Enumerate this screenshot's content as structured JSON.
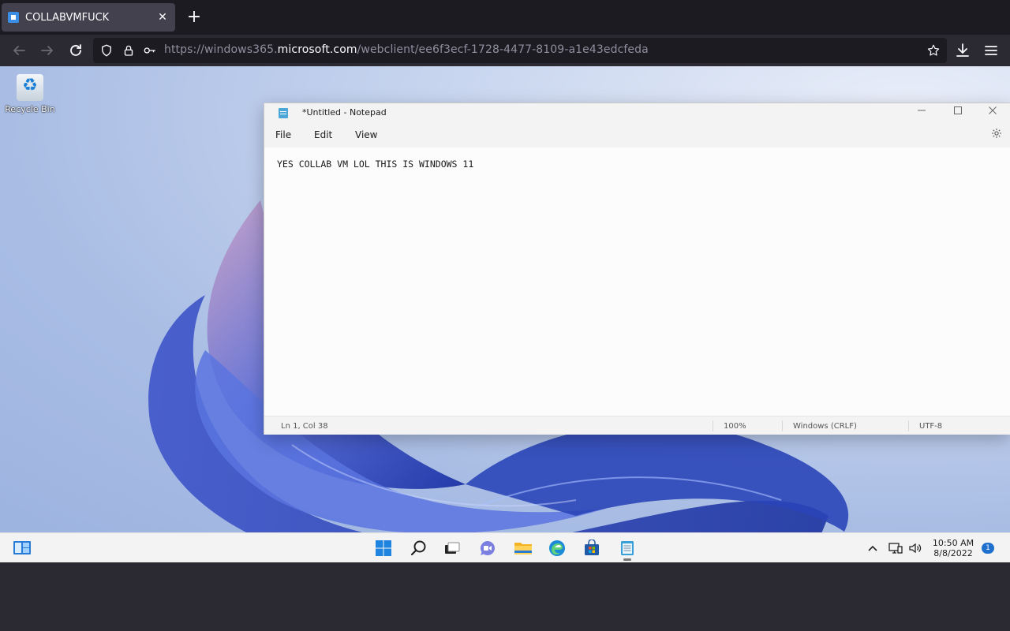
{
  "browser": {
    "tab_title": "COLLABVMFUCK",
    "close_glyph": "✕",
    "newtab_glyph": "+",
    "url_prefix": "https://windows365.",
    "url_domain": "microsoft.com",
    "url_path": "/webclient/ee6f3ecf-1728-4477-8109-a1e43edcfeda"
  },
  "desktop": {
    "recycle_bin_label": "Recycle Bin"
  },
  "notepad": {
    "title": "*Untitled - Notepad",
    "menu": {
      "file": "File",
      "edit": "Edit",
      "view": "View"
    },
    "content": "YES COLLAB VM LOL THIS IS WINDOWS 11",
    "status": {
      "position": "Ln 1, Col 38",
      "zoom": "100%",
      "line_ending": "Windows (CRLF)",
      "encoding": "UTF-8"
    }
  },
  "taskbar": {
    "time": "10:50 AM",
    "date": "8/8/2022",
    "notification_count": "1"
  },
  "colors": {
    "browser_bg": "#1c1b22",
    "toolbar_bg": "#2b2a33",
    "accent": "#0078d4"
  }
}
